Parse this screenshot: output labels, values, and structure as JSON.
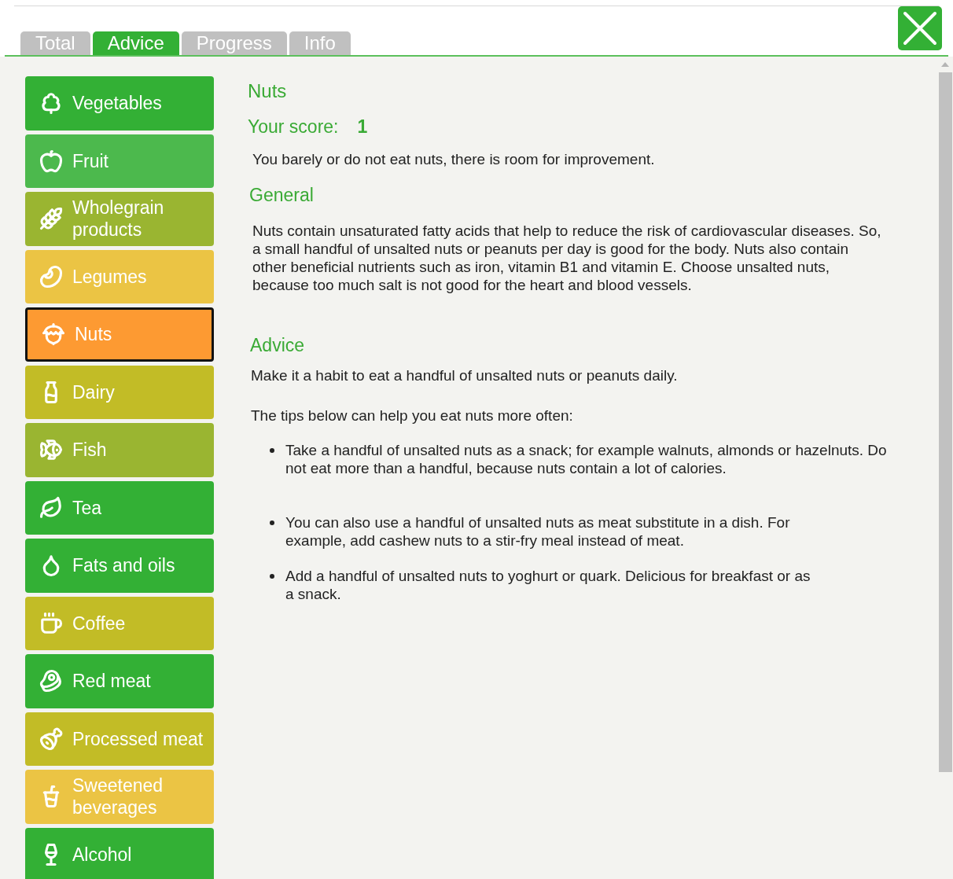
{
  "tabs": [
    {
      "label": "Total",
      "selected": false
    },
    {
      "label": "Advice",
      "selected": true
    },
    {
      "label": "Progress",
      "selected": false
    },
    {
      "label": "Info",
      "selected": false
    }
  ],
  "sidebar": {
    "items": [
      {
        "label": "Vegetables",
        "color": "#33b035",
        "selected": false
      },
      {
        "label": "Fruit",
        "color": "#4cb94d",
        "selected": false
      },
      {
        "label": "Wholegrain products",
        "color": "#9ab531",
        "selected": false
      },
      {
        "label": "Legumes",
        "color": "#ebc444",
        "selected": false
      },
      {
        "label": "Nuts",
        "color": "#fd9a32",
        "selected": true
      },
      {
        "label": "Dairy",
        "color": "#c2bc26",
        "selected": false
      },
      {
        "label": "Fish",
        "color": "#9ab531",
        "selected": false
      },
      {
        "label": "Tea",
        "color": "#33b035",
        "selected": false
      },
      {
        "label": "Fats and oils",
        "color": "#33b035",
        "selected": false
      },
      {
        "label": "Coffee",
        "color": "#c2bc26",
        "selected": false
      },
      {
        "label": "Red meat",
        "color": "#33b035",
        "selected": false
      },
      {
        "label": "Processed meat",
        "color": "#c2bc26",
        "selected": false
      },
      {
        "label": "Sweetened beverages",
        "color": "#ebc444",
        "selected": false
      },
      {
        "label": "Alcohol",
        "color": "#33b035",
        "selected": false
      }
    ]
  },
  "content": {
    "title": "Nuts",
    "score_label": "Your score:",
    "score": "1",
    "summary": "You barely or do not eat nuts, there is room for improvement.",
    "general_heading": "General",
    "general_text": "Nuts contain unsaturated fatty acids that help to reduce the risk of cardiovascular diseases. So, a small handful of unsalted nuts or peanuts per day is good for the body. Nuts also contain other beneficial nutrients such as iron, vitamin B1 and vitamin E. Choose unsalted nuts, because too much salt is not good for the heart and blood vessels.",
    "advice_heading": "Advice",
    "advice_text": "Make it a habit to eat a handful of unsalted nuts or peanuts daily.",
    "tips_intro": "The tips below can help you eat nuts more often:",
    "tips": [
      "Take a handful of unsalted nuts as a snack; for example walnuts, almonds or hazelnuts. Do not eat more than a handful, because nuts contain a lot of calories.",
      "You can also use a handful of unsalted nuts as meat substitute in a dish. For example, add cashew nuts to a stir-fry meal instead of meat.",
      "Add a handful of unsalted nuts to yoghurt or quark. Delicious for breakfast or as a snack."
    ]
  }
}
